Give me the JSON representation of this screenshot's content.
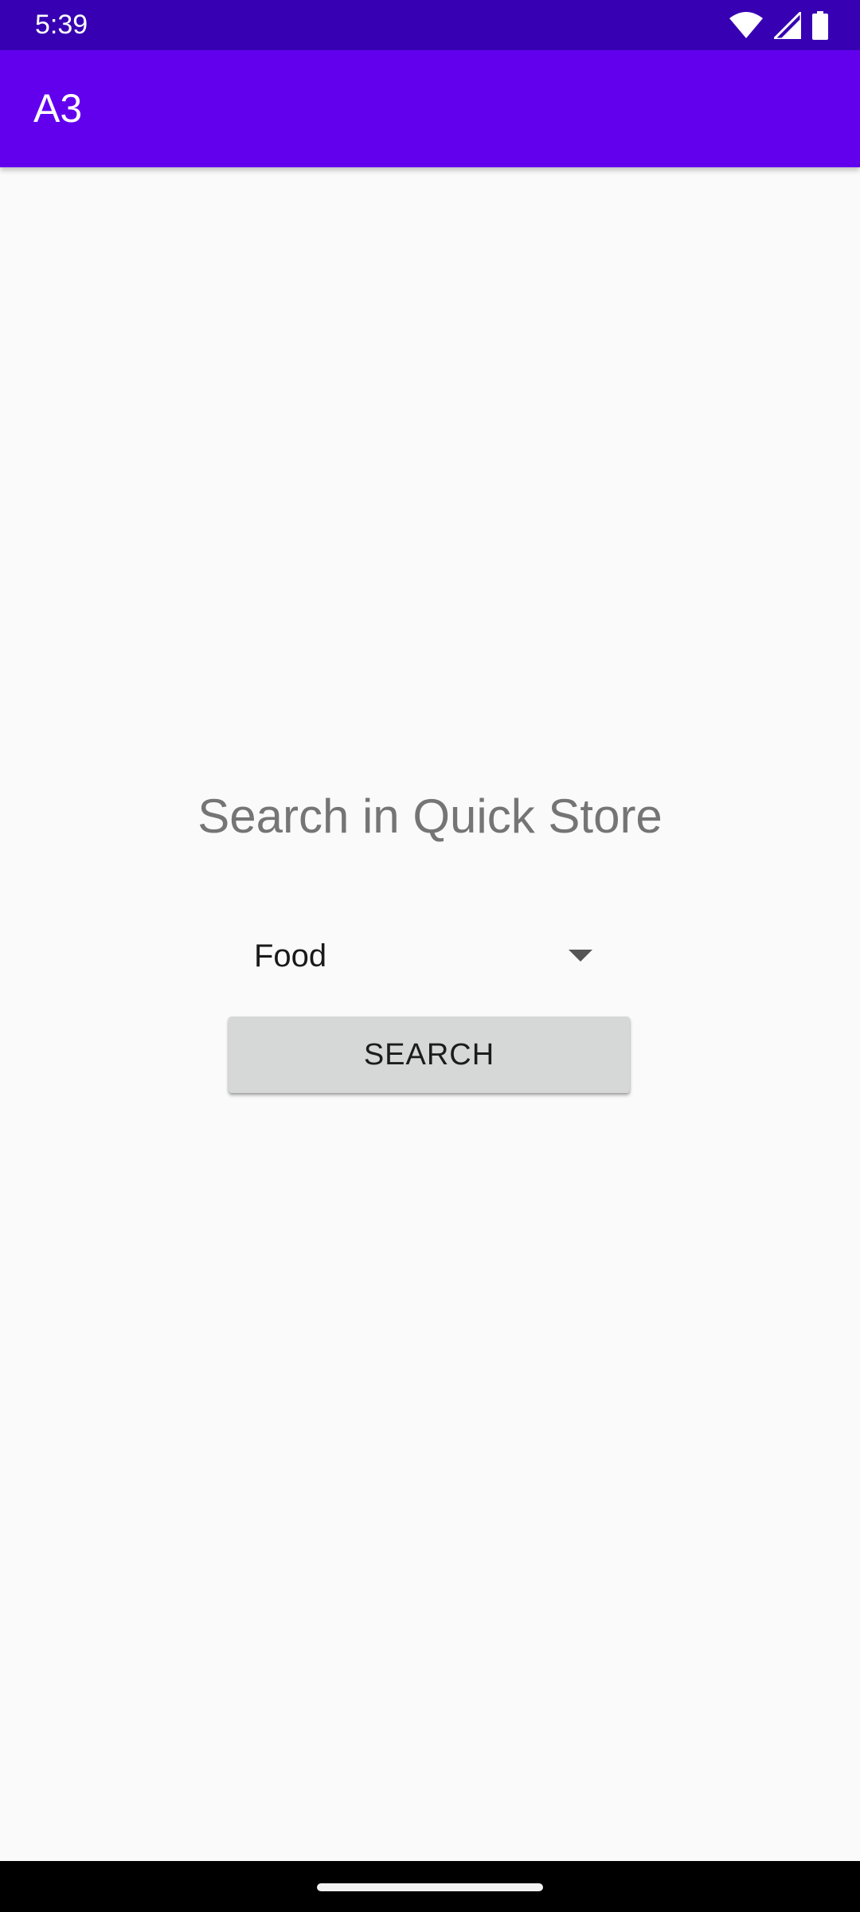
{
  "status_bar": {
    "time": "5:39",
    "icons": [
      "wifi-icon",
      "signal-icon",
      "battery-icon"
    ]
  },
  "app_bar": {
    "title": "A3"
  },
  "main": {
    "headline": "Search in Quick Store",
    "category_spinner": {
      "selected": "Food"
    },
    "search_button_label": "SEARCH"
  },
  "colors": {
    "status_bar": "#3700b3",
    "app_bar": "#6200ee",
    "background": "#fafafa",
    "button": "#d6d7d7"
  }
}
